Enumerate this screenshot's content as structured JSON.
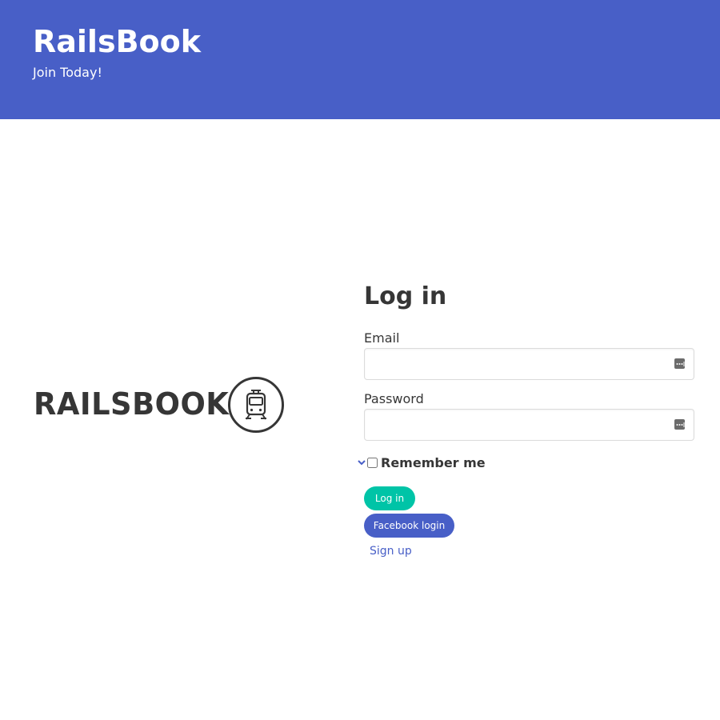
{
  "hero": {
    "title": "RailsBook",
    "subtitle": "Join Today!"
  },
  "logo": {
    "wordmark": "RAILSBOOK",
    "emblem_icon": "train-icon"
  },
  "login_form": {
    "title": "Log in",
    "email_label": "Email",
    "email_value": "",
    "email_field_icon": "password-manager-key-icon",
    "password_label": "Password",
    "password_value": "",
    "password_field_icon": "password-manager-key-icon",
    "remember_label": "Remember me",
    "remember_checked": false,
    "login_button": "Log in",
    "facebook_button": "Facebook login",
    "signup_link": "Sign up"
  },
  "colors": {
    "hero_background": "#485fc7",
    "primary_button": "#00c4a7",
    "link_button": "#485fc7",
    "text": "#363636"
  }
}
